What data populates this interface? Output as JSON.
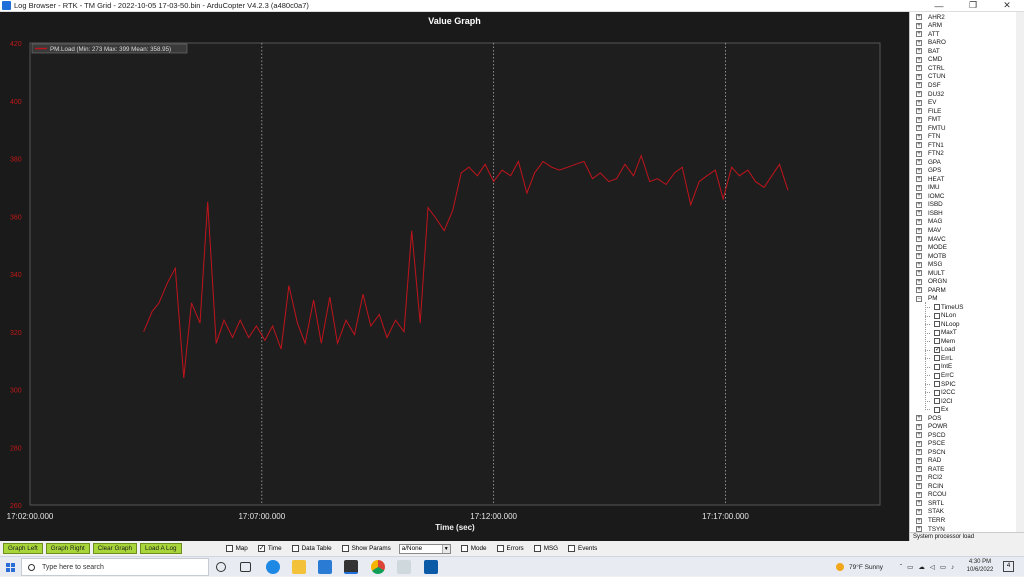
{
  "window": {
    "title": "Log Browser - RTK - TM Grid - 2022-10-05 17-03-50.bin - ArduCopter V4.2.3 (a480c0a7)",
    "controls": [
      "—",
      "❐",
      "✕"
    ]
  },
  "graph": {
    "title": "Value Graph",
    "legend": "PM.Load  (Min: 273 Max: 399 Mean: 358.95)",
    "xlabel": "Time (sec)"
  },
  "chart_data": {
    "type": "line",
    "title": "Value Graph",
    "xlabel": "Time (sec)",
    "ylabel": "",
    "x_tick_labels": [
      "17:02:00.000",
      "17:07:00.000",
      "17:12:00.000",
      "17:17:00.000"
    ],
    "x_tick_seconds": [
      0,
      300,
      600,
      900
    ],
    "xlim_seconds": [
      0,
      1100
    ],
    "y_tick_labels": [
      "420",
      "400",
      "380",
      "360",
      "340",
      "320",
      "300",
      "280",
      "260"
    ],
    "ylim": [
      260,
      420
    ],
    "grid": "vertical dotted",
    "series": [
      {
        "name": "PM.Load",
        "color": "#c0141c",
        "x": [
          147,
          158,
          167,
          178,
          188,
          199,
          209,
          220,
          230,
          241,
          251,
          262,
          272,
          283,
          293,
          304,
          314,
          325,
          335,
          346,
          356,
          367,
          377,
          388,
          398,
          409,
          420,
          431,
          441,
          452,
          462,
          473,
          484,
          494,
          505,
          515,
          526,
          536,
          547,
          558,
          568,
          579,
          589,
          600,
          611,
          622,
          632,
          643,
          653,
          664,
          675,
          685,
          696,
          706,
          717,
          728,
          738,
          749,
          759,
          770,
          781,
          791,
          802,
          812,
          823,
          834,
          844,
          855,
          866,
          876,
          887,
          897,
          908,
          918,
          929,
          939,
          950,
          960,
          970,
          981
        ],
        "y": [
          320,
          327,
          330,
          337,
          342,
          304,
          330,
          323,
          365,
          316,
          324,
          318,
          324,
          318,
          322,
          317,
          322,
          314,
          336,
          323,
          316,
          331,
          316,
          332,
          316,
          324,
          319,
          333,
          322,
          326,
          318,
          324,
          320,
          355,
          323,
          363,
          359,
          355,
          362,
          375,
          377,
          374,
          378,
          372,
          376,
          374,
          379,
          368,
          375,
          379,
          377,
          376,
          377,
          378,
          379,
          373,
          375,
          372,
          373,
          378,
          374,
          381,
          372,
          373,
          371,
          375,
          377,
          364,
          372,
          374,
          376,
          366,
          377,
          374,
          376,
          372,
          370,
          374,
          378,
          369
        ]
      }
    ]
  },
  "tree": {
    "collapsed_top": [
      "AHR2",
      "ARM",
      "ATT",
      "BARO",
      "BAT",
      "CMD",
      "CTRL",
      "CTUN",
      "DSF",
      "DU32",
      "EV",
      "FILE",
      "FMT",
      "FMTU",
      "FTN",
      "FTN1",
      "FTN2",
      "GPA",
      "GPS",
      "HEAT",
      "IMU",
      "IOMC",
      "ISBD",
      "ISBH",
      "MAG",
      "MAV",
      "MAVC",
      "MODE",
      "MOTB",
      "MSG",
      "MULT",
      "ORGN",
      "PARM"
    ],
    "expanded": "PM",
    "children": [
      {
        "label": "TimeUS",
        "checked": false
      },
      {
        "label": "NLon",
        "checked": false
      },
      {
        "label": "NLoop",
        "checked": false
      },
      {
        "label": "MaxT",
        "checked": false
      },
      {
        "label": "Mem",
        "checked": false
      },
      {
        "label": "Load",
        "checked": true
      },
      {
        "label": "ErrL",
        "checked": false
      },
      {
        "label": "IntE",
        "checked": false
      },
      {
        "label": "ErrC",
        "checked": false
      },
      {
        "label": "SPIC",
        "checked": false
      },
      {
        "label": "I2CC",
        "checked": false
      },
      {
        "label": "I2CI",
        "checked": false
      },
      {
        "label": "Ex",
        "checked": false
      }
    ],
    "collapsed_bottom": [
      "POS",
      "POWR",
      "PSCD",
      "PSCE",
      "PSCN",
      "RAD",
      "RATE",
      "RCI2",
      "RCIN",
      "RCOU",
      "SRTL",
      "STAK",
      "TERR",
      "TSYN"
    ],
    "status": "System processor load"
  },
  "controls": {
    "buttons": [
      "Graph Left",
      "Graph Right",
      "Clear Graph",
      "Load A Log"
    ],
    "checkboxes_left": [
      {
        "label": "Map",
        "checked": false
      },
      {
        "label": "Time",
        "checked": true
      },
      {
        "label": "Data Table",
        "checked": false
      },
      {
        "label": "Show Params",
        "checked": false
      }
    ],
    "combo_value": "a/None",
    "checkboxes_right": [
      {
        "label": "Mode",
        "checked": false
      },
      {
        "label": "Errors",
        "checked": false
      },
      {
        "label": "MSG",
        "checked": false
      },
      {
        "label": "Events",
        "checked": false
      }
    ]
  },
  "taskbar": {
    "search_placeholder": "Type here to search",
    "weather": "79°F  Sunny",
    "time": "4:30 PM",
    "date": "10/6/2022",
    "notifications": "4"
  }
}
